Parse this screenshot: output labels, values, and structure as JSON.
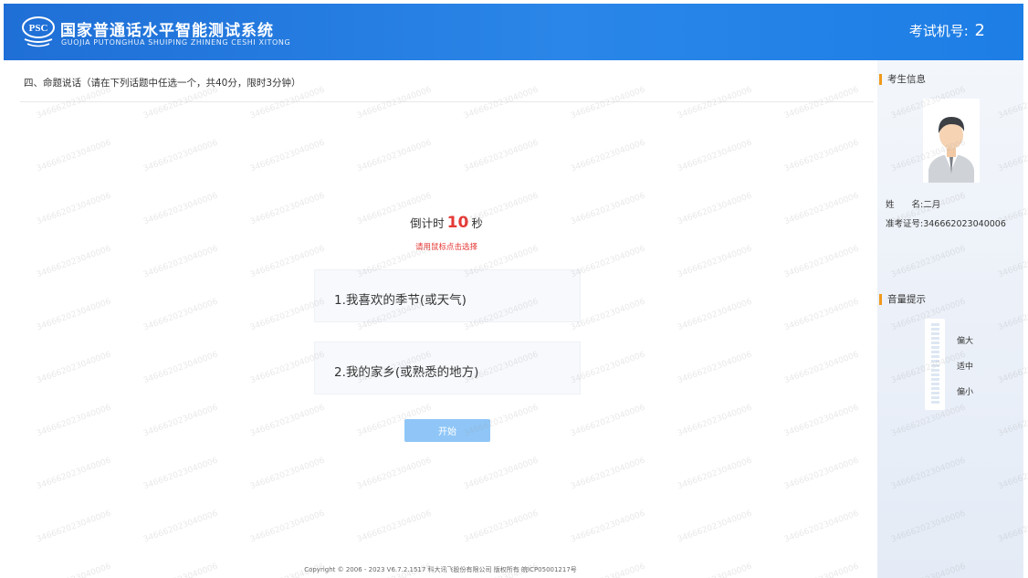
{
  "header": {
    "logo_text": "PSC",
    "title": "国家普通话水平智能测试系统",
    "subtitle": "GUOJIA PUTONGHUA SHUIPING ZHINENG CESHI XITONG",
    "exam_machine_label": "考试机号:",
    "exam_machine_no": "2"
  },
  "main": {
    "section_title": "四、命题说话（请在下列话题中任选一个，共40分，限时3分钟）",
    "countdown_prefix": "倒计时",
    "countdown_seconds": "10",
    "countdown_suffix": "秒",
    "hint": "请用鼠标点击选择",
    "topics": [
      {
        "label": "1.我喜欢的季节(或天气)"
      },
      {
        "label": "2.我的家乡(或熟悉的地方)"
      }
    ],
    "start_label": "开始",
    "footer": "Copyright © 2006 - 2023 V6.7.2.1517 科大讯飞股份有限公司 版权所有 皖ICP05001217号"
  },
  "sidebar": {
    "candidate_title": "考生信息",
    "name_label": "姓　　名:",
    "name_value": "二月",
    "id_label": "准考证号:",
    "id_value": "346662023040006",
    "volume_title": "音量提示",
    "volume_high": "偏大",
    "volume_mid": "适中",
    "volume_low": "偏小"
  },
  "watermark": {
    "text": "346662023040006"
  },
  "colors": {
    "header_blue": "#2a86e8",
    "countdown_red": "#e53935",
    "accent_orange": "#f09a1a",
    "start_button": "#8fc6f7"
  }
}
